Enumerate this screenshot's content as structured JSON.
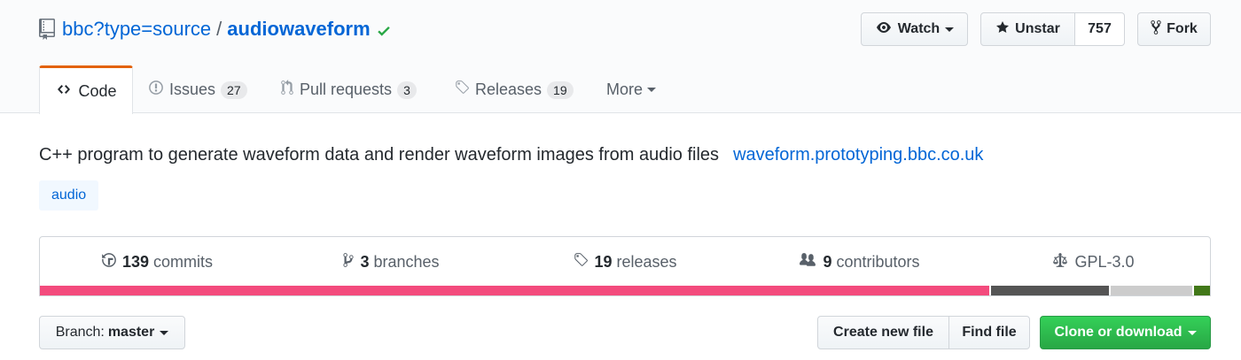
{
  "repo": {
    "owner": "bbc?type=source",
    "separator": "/",
    "name": "audiowaveform"
  },
  "actions": {
    "watch_label": "Watch",
    "unstar_label": "Unstar",
    "star_count": "757",
    "fork_label": "Fork"
  },
  "tabs": [
    {
      "label": "Code",
      "count": ""
    },
    {
      "label": "Issues",
      "count": "27"
    },
    {
      "label": "Pull requests",
      "count": "3"
    },
    {
      "label": "Releases",
      "count": "19"
    },
    {
      "label": "More",
      "count": ""
    }
  ],
  "description": {
    "text": "C++ program to generate waveform data and render waveform images from audio files",
    "homepage": "waveform.prototyping.bbc.co.uk",
    "topics": [
      "audio"
    ]
  },
  "summary": {
    "commits_num": "139",
    "commits_label": "commits",
    "branches_num": "3",
    "branches_label": "branches",
    "releases_num": "19",
    "releases_label": "releases",
    "contributors_num": "9",
    "contributors_label": "contributors",
    "license": "GPL-3.0"
  },
  "languages": [
    {
      "color": "#f34b7d",
      "share": 0.8255
    },
    {
      "color": "#555555",
      "share": 0.1044
    },
    {
      "color": "#cccccc",
      "share": 0.0726
    },
    {
      "color": "#427819",
      "share": 0.0151
    }
  ],
  "file_nav": {
    "branch_prefix": "Branch:",
    "branch_name": "master",
    "create_label": "Create new file",
    "find_label": "Find file",
    "clone_label": "Clone or download"
  },
  "colors": {
    "link": "#0366d6",
    "tab_accent": "#e36209",
    "verified": "#28a745",
    "primary_button": "#28a745"
  }
}
